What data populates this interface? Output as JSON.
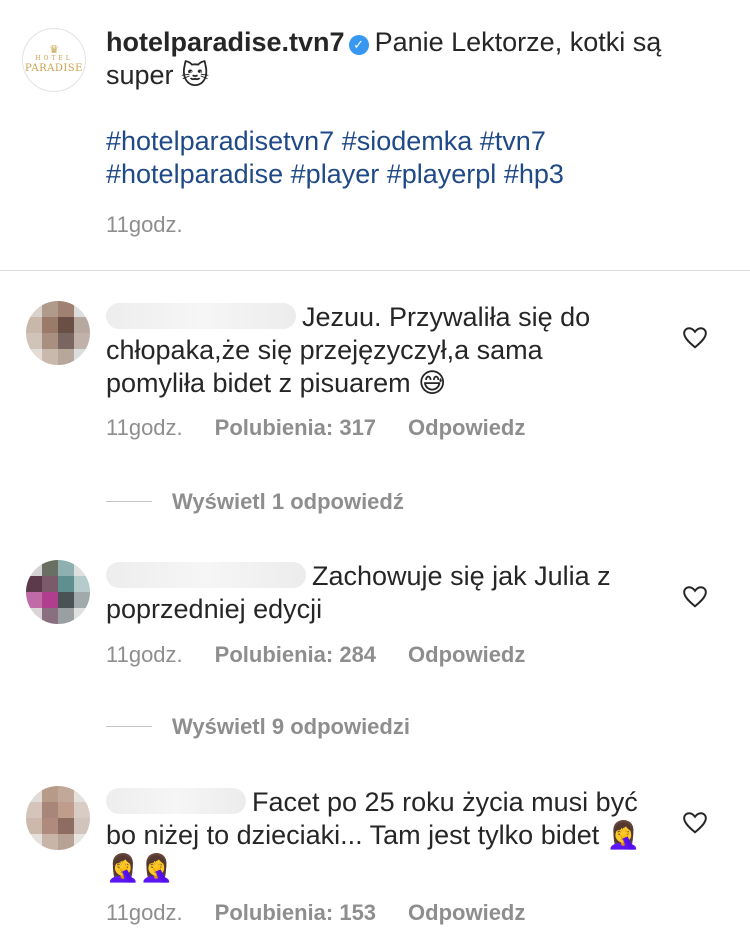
{
  "post": {
    "username": "hotelparadise.tvn7",
    "logo_lines": [
      "HOTEL",
      "PARADISE"
    ],
    "caption": "Panie Lektorze, kotki są super 🐱",
    "hashtags_line1": [
      "#hotelparadisetvn7",
      "#siodemka",
      "#tvn7"
    ],
    "hashtags_line2": [
      "#hotelparadise",
      "#player",
      "#playerpl",
      "#hp3"
    ],
    "time": "11godz."
  },
  "comments": [
    {
      "text_line1": "Jezuu. Przywaliła się do",
      "text_rest": "chłopaka,że się przejęzyczył,a sama pomyliła bidet z pisuarem 😅",
      "time": "11godz.",
      "likes": "Polubienia: 317",
      "reply": "Odpowiedz",
      "view_replies": "Wyświetl 1 odpowiedź"
    },
    {
      "text_line1": "Zachowuje się jak Julia z",
      "text_rest": "poprzedniej edycji",
      "time": "11godz.",
      "likes": "Polubienia: 284",
      "reply": "Odpowiedz",
      "view_replies": "Wyświetl 9 odpowiedzi"
    },
    {
      "text_line1": "Facet po 25 roku życia musi",
      "text_rest": "być bo niżej to dzieciaki... Tam jest tylko bidet 🤦‍♀️🤦‍♀️🤦‍♀️",
      "time": "11godz.",
      "likes": "Polubienia: 153",
      "reply": "Odpowiedz"
    }
  ],
  "colors": {
    "hashtag": "#1f4a87",
    "muted": "#8e8e8e",
    "verified": "#3897f0",
    "text": "#262626"
  },
  "icons": [
    "verified-badge-icon",
    "heart-icon"
  ]
}
